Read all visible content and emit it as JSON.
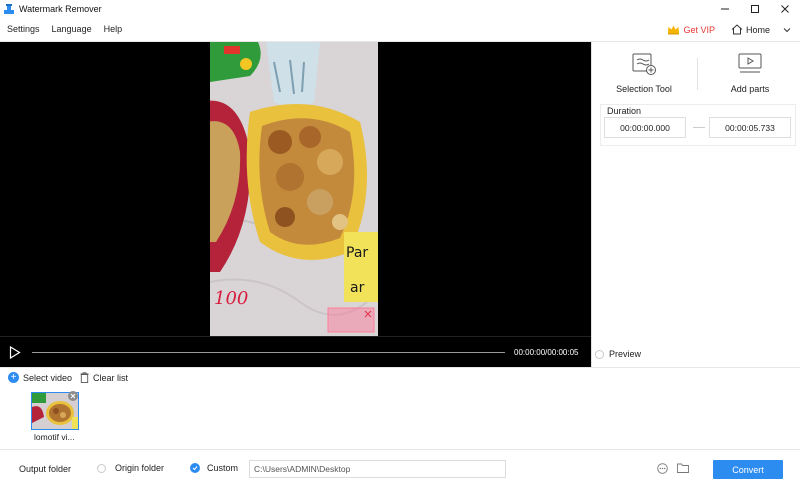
{
  "window": {
    "title": "Watermark Remover"
  },
  "menu": {
    "items": [
      "Settings",
      "Language",
      "Help"
    ],
    "vip_label": "Get VIP",
    "home_label": "Home"
  },
  "player": {
    "time": "00:00:00/00:00:05",
    "frame_overlay_text_1": "Par",
    "frame_overlay_text_2": "ar",
    "frame_overlay_text_3": "100"
  },
  "tools": {
    "selection_tool": "Selection Tool",
    "add_parts": "Add parts"
  },
  "duration": {
    "title": "Duration",
    "start": "00:00:00.000",
    "end": "00:00:05.733"
  },
  "preview_label": "Preview",
  "list": {
    "select_video": "Select video",
    "clear_list": "Clear list",
    "items": [
      {
        "name": "lomotif vi..."
      }
    ]
  },
  "output": {
    "label": "Output folder",
    "origin_folder": "Origin folder",
    "custom": "Custom",
    "path": "C:\\Users\\ADMIN\\Desktop",
    "selected": "custom"
  },
  "convert_label": "Convert",
  "colors": {
    "accent": "#2d8cf0",
    "vip": "#e53935"
  }
}
